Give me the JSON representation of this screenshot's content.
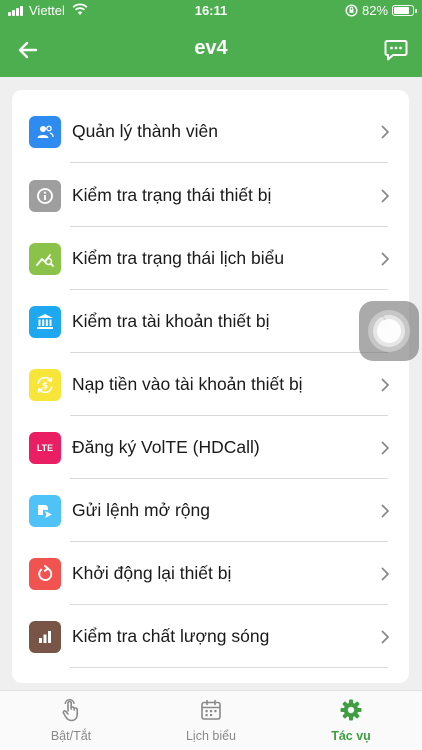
{
  "status_bar": {
    "carrier": "Viettel",
    "time": "16:11",
    "battery": "82%",
    "battery_level": 0.82
  },
  "header": {
    "title": "ev4",
    "back_icon": "arrow-left-icon",
    "chat_icon": "chat-bubble-icon"
  },
  "menu": {
    "items": [
      {
        "label": "Quản lý thành viên",
        "icon": "members-icon",
        "color": "#2f8bf0"
      },
      {
        "label": "Kiểm tra trạng thái thiết bị",
        "icon": "info-icon",
        "color": "#9e9e9e"
      },
      {
        "label": "Kiểm tra trạng thái lịch biểu",
        "icon": "chart-search-icon",
        "color": "#8bc34a"
      },
      {
        "label": "Kiểm tra tài khoản thiết bị",
        "icon": "bank-icon",
        "color": "#1ea8f0"
      },
      {
        "label": "Nạp tiền vào tài khoản thiết bị",
        "icon": "money-refresh-icon",
        "color": "#f7e53a"
      },
      {
        "label": "Đăng ký VolTE (HDCall)",
        "icon": "lte-icon",
        "icon_text": "LTE",
        "color": "#e91e63"
      },
      {
        "label": "Gửi lệnh mở rộng",
        "icon": "send-extend-icon",
        "color": "#4fc3f7"
      },
      {
        "label": "Khởi động lại thiết bị",
        "icon": "restart-icon",
        "color": "#f05350"
      },
      {
        "label": "Kiểm tra chất lượng sóng",
        "icon": "signal-bars-icon",
        "color": "#795548"
      }
    ]
  },
  "tabs": [
    {
      "label": "Bật/Tắt",
      "icon": "touch-hand-icon",
      "active": false
    },
    {
      "label": "Lịch biểu",
      "icon": "calendar-icon",
      "active": false
    },
    {
      "label": "Tác vụ",
      "icon": "gear-icon",
      "active": true
    }
  ],
  "colors": {
    "primary": "#4cae4f",
    "active_tab": "#3f9d42"
  }
}
